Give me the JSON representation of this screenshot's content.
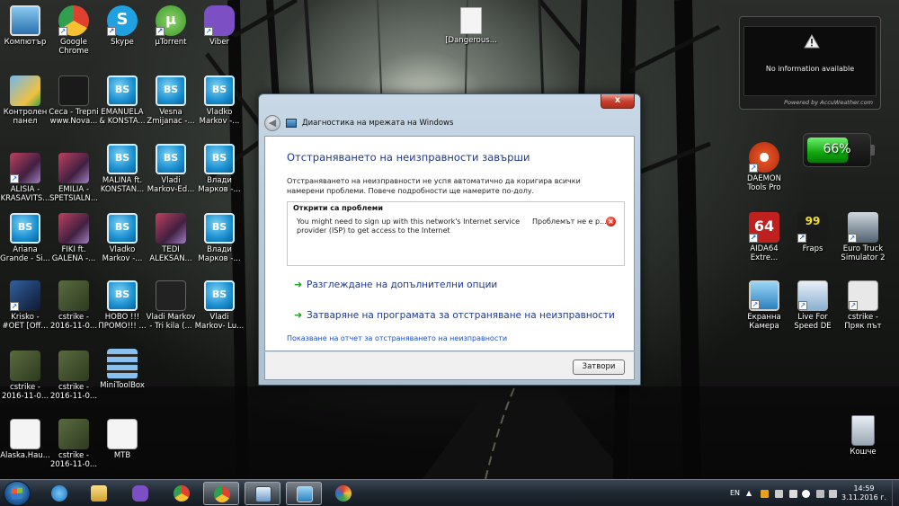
{
  "desktop": {
    "icons": [
      {
        "label": "Компютър"
      },
      {
        "label": "Google\nChrome"
      },
      {
        "label": "Skype"
      },
      {
        "label": "µTorrent"
      },
      {
        "label": "Viber"
      },
      {
        "label": "[Dangerous..."
      },
      {
        "label": "Контролен\nпанел"
      },
      {
        "label": "Ceca - Trepni\nwww.Nova..."
      },
      {
        "label": "EMANUELA\n& KONSTA..."
      },
      {
        "label": "Vesna\nZmijanac -..."
      },
      {
        "label": "Vladko\nMarkov -..."
      },
      {
        "label": "ALISIA -\nKRASAVITS..."
      },
      {
        "label": "EMILIA -\nSPETSIALN..."
      },
      {
        "label": "MALINA ft.\nKONSTAN..."
      },
      {
        "label": "Vladi\nMarkov-Ed..."
      },
      {
        "label": "Влади\nМарков -..."
      },
      {
        "label": "Ariana\nGrande - Si..."
      },
      {
        "label": "FIKI ft.\nGALENA -..."
      },
      {
        "label": "Vladko\nMarkov -..."
      },
      {
        "label": "TEDI\nALEKSAN..."
      },
      {
        "label": "Влади\nМарков -..."
      },
      {
        "label": "Krisko -\n#OET [Off..."
      },
      {
        "label": "cstrike -\n2016-11-0..."
      },
      {
        "label": "НОВО !!!\nПРОМО!!! ..."
      },
      {
        "label": "Vladi Markov\n- Tri kila (..."
      },
      {
        "label": "Vladi\nMarkov- Lu..."
      },
      {
        "label": "cstrike -\n2016-11-0..."
      },
      {
        "label": "cstrike -\n2016-11-0..."
      },
      {
        "label": "MiniToolBox"
      },
      {
        "label": "Alaska.Hau..."
      },
      {
        "label": "cstrike -\n2016-11-0..."
      },
      {
        "label": "MTB"
      },
      {
        "label": "DAEMON\nTools Pro"
      },
      {
        "label": "AIDA64\nExtre..."
      },
      {
        "label": "Fraps"
      },
      {
        "label": "Euro Truck\nSimulator 2"
      },
      {
        "label": "Екранна\nКамера"
      },
      {
        "label": "Live For\nSpeed DE"
      },
      {
        "label": "cstrike -\nПряк път"
      },
      {
        "label": "Кошче"
      }
    ]
  },
  "weather_gadget": {
    "message": "No information available",
    "powered_by": "Powered by AccuWeather.com"
  },
  "battery_gadget": {
    "percent_label": "66%",
    "level": 0.66
  },
  "dialog": {
    "title": "Диагностика на мрежата на Windows",
    "close_glyph": "x",
    "heading": "Отстраняването на неизправности завърши",
    "description": "Отстраняването на неизправности не успя автоматично да коригира всички намерени проблеми. Повече подробности ще намерите по-долу.",
    "problems_header": "Открити са проблеми",
    "problem_text": "You might need to sign up with this network's Internet service provider (ISP) to get access to the Internet",
    "problem_status": "Проблемът не е р...",
    "options": [
      {
        "label": "Разглеждане на допълнителни опции"
      },
      {
        "label": "Затваряне на програмата за отстраняване на неизправности"
      }
    ],
    "report_link": "Показване на отчет за отстраняването на неизправности",
    "close_button": "Затвори"
  },
  "taskbar": {
    "language": "EN",
    "time": "14:59",
    "date": "3.11.2016 г."
  },
  "colors": {
    "heading_blue": "#1e3a8a",
    "link_blue": "#1a50c0",
    "option_arrow_green": "#2a9a2a"
  }
}
